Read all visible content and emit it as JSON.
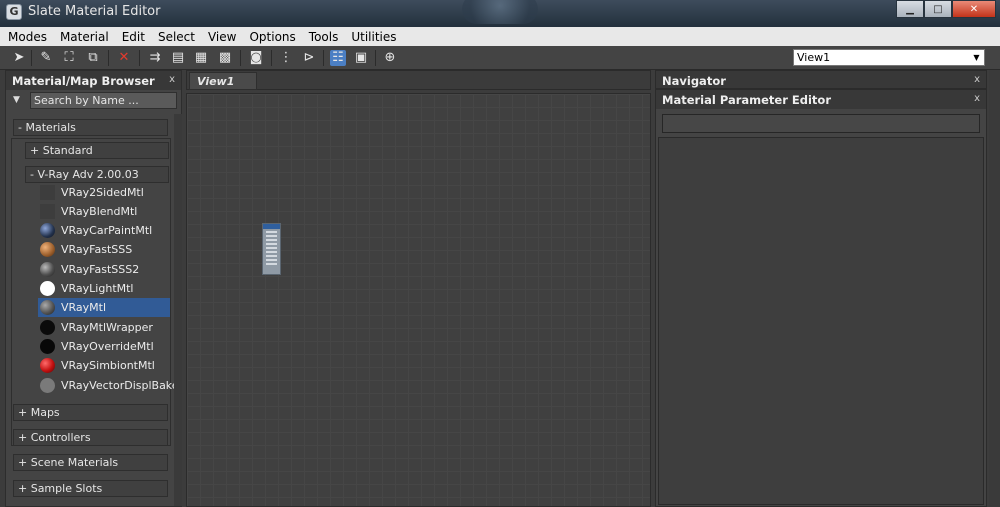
{
  "window": {
    "title": "Slate Material Editor",
    "app_icon_glyph": "G",
    "controls": {
      "minimize": "▁",
      "maximize": "□",
      "close": "✕"
    }
  },
  "menu": [
    "Modes",
    "Material",
    "Edit",
    "Select",
    "View",
    "Options",
    "Tools",
    "Utilities"
  ],
  "toolbar": {
    "icons": [
      {
        "name": "select-arrow-icon",
        "glyph": "➤"
      },
      {
        "name": "pick-material-icon",
        "glyph": "✎"
      },
      {
        "name": "put-to-scene-icon",
        "glyph": "⛶"
      },
      {
        "name": "assign-selection-icon",
        "glyph": "⧉"
      },
      {
        "name": "delete-icon",
        "glyph": "✕"
      },
      {
        "name": "move-children-icon",
        "glyph": "⇉"
      },
      {
        "name": "hide-unused-icon",
        "glyph": "▤"
      },
      {
        "name": "show-map-icon",
        "glyph": "▦"
      },
      {
        "name": "show-background-icon",
        "glyph": "▩"
      },
      {
        "name": "background-icon",
        "glyph": "◙"
      },
      {
        "name": "layout-vertical-icon",
        "glyph": "⋮"
      },
      {
        "name": "layout-children-icon",
        "glyph": "⊳"
      },
      {
        "name": "material-map-browser-icon",
        "glyph": "☷"
      },
      {
        "name": "parameter-editor-icon",
        "glyph": "▣"
      },
      {
        "name": "select-by-material-icon",
        "glyph": "⊕"
      }
    ],
    "view_select": "View1"
  },
  "browser": {
    "title": "Material/Map Browser",
    "close": "x",
    "search_placeholder": "Search by Name ...",
    "groups": [
      {
        "label": "- Materials"
      },
      {
        "label": "+ Standard"
      },
      {
        "label": "- V-Ray Adv 2.00.03"
      }
    ],
    "materials": [
      {
        "label": "VRay2SidedMtl",
        "swatch": "flat",
        "color": "#3d3d3d"
      },
      {
        "label": "VRayBlendMtl",
        "swatch": "flat",
        "color": "#3d3d3d"
      },
      {
        "label": "VRayCarPaintMtl",
        "swatch": "sphere",
        "color": "#23324d"
      },
      {
        "label": "VRayFastSSS",
        "swatch": "sphere",
        "color": "#9a5d2a"
      },
      {
        "label": "VRayFastSSS2",
        "swatch": "sphere",
        "color": "#505050"
      },
      {
        "label": "VRayLightMtl",
        "swatch": "sphere",
        "color": "#ffffff"
      },
      {
        "label": "VRayMtl",
        "swatch": "sphere",
        "color": "#555555",
        "selected": true
      },
      {
        "label": "VRayMtlWrapper",
        "swatch": "sphere",
        "color": "#0b0b0b"
      },
      {
        "label": "VRayOverrideMtl",
        "swatch": "sphere",
        "color": "#080808"
      },
      {
        "label": "VRaySimbiontMtl",
        "swatch": "sphere",
        "color": "#c21010"
      },
      {
        "label": "VRayVectorDisplBake",
        "swatch": "sphere",
        "color": "#7a7a7a"
      }
    ],
    "bottom_groups": [
      {
        "label": "+ Maps"
      },
      {
        "label": "+ Controllers"
      },
      {
        "label": "+ Scene Materials"
      },
      {
        "label": "+ Sample Slots"
      }
    ]
  },
  "view": {
    "tab": "View1"
  },
  "navigator": {
    "title": "Navigator",
    "close": "x"
  },
  "parameter_editor": {
    "title": "Material Parameter Editor",
    "close": "x"
  }
}
